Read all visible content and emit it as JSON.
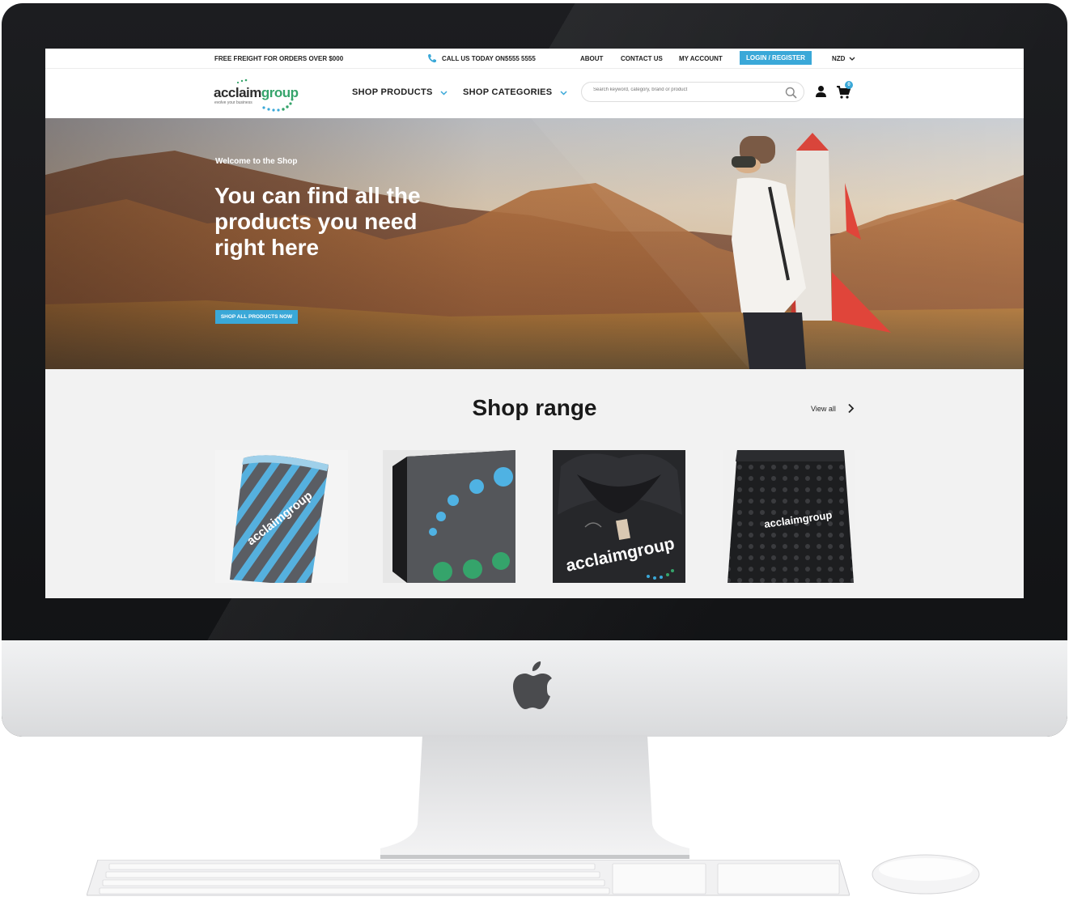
{
  "topbar": {
    "freight": "FREE FREIGHT FOR ORDERS OVER $000",
    "call_label": "CALL US TODAY ON:",
    "phone": "5555 5555",
    "links": [
      "ABOUT",
      "CONTACT US",
      "MY ACCOUNT"
    ],
    "login": "LOGIN / REGISTER",
    "currency": "NZD"
  },
  "header": {
    "logo_main": "acclaim",
    "logo_accent": "group",
    "logo_tagline": "evolve your business",
    "nav": [
      "SHOP PRODUCTS",
      "SHOP CATEGORIES"
    ],
    "search_placeholder": "Search keyword, category, brand or product",
    "cart_count": "0"
  },
  "hero": {
    "kicker": "Welcome to the Shop",
    "title": "You can find all the products you need right here",
    "button": "SHOP ALL PRODUCTS NOW"
  },
  "range": {
    "title": "Shop range",
    "view_all": "View all",
    "products": [
      {
        "label": "acclaimgroup"
      },
      {
        "label": ""
      },
      {
        "label": "acclaimgroup"
      },
      {
        "label": "acclaimgroup"
      }
    ]
  },
  "colors": {
    "accent_blue": "#3aa8d8",
    "accent_green": "#35a46b",
    "hero_sky": "#e9d3b4"
  }
}
